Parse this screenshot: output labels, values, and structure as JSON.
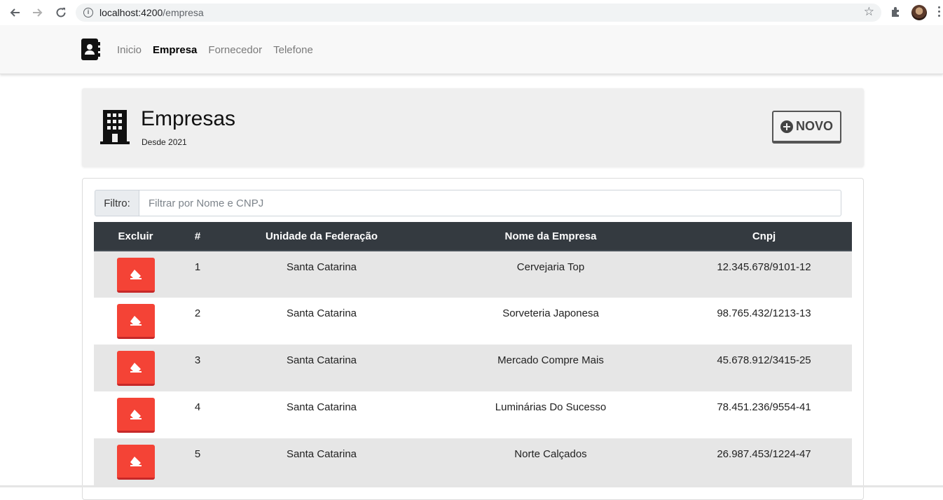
{
  "browser": {
    "url_host": "localhost:4200",
    "url_path": "/empresa"
  },
  "navbar": {
    "links": [
      {
        "label": "Inicio",
        "active": false
      },
      {
        "label": "Empresa",
        "active": true
      },
      {
        "label": "Fornecedor",
        "active": false
      },
      {
        "label": "Telefone",
        "active": false
      }
    ]
  },
  "header": {
    "title": "Empresas",
    "subtitle": "Desde 2021",
    "new_button_label": "NOVO"
  },
  "filter": {
    "label": "Filtro:",
    "placeholder": "Filtrar por Nome e CNPJ",
    "value": ""
  },
  "table": {
    "columns": [
      "Excluir",
      "#",
      "Unidade da Federação",
      "Nome da Empresa",
      "Cnpj"
    ],
    "rows": [
      {
        "id": "1",
        "uf": "Santa Catarina",
        "nome": "Cervejaria Top",
        "cnpj": "12.345.678/9101-12"
      },
      {
        "id": "2",
        "uf": "Santa Catarina",
        "nome": "Sorveteria Japonesa",
        "cnpj": "98.765.432/1213-13"
      },
      {
        "id": "3",
        "uf": "Santa Catarina",
        "nome": "Mercado Compre Mais",
        "cnpj": "45.678.912/3415-25"
      },
      {
        "id": "4",
        "uf": "Santa Catarina",
        "nome": "Luminárias Do Sucesso",
        "cnpj": "78.451.236/9554-41"
      },
      {
        "id": "5",
        "uf": "Santa Catarina",
        "nome": "Norte Calçados",
        "cnpj": "26.987.453/1224-47"
      }
    ]
  },
  "colors": {
    "table_header_bg": "#343a40",
    "delete_button": "#f44336",
    "striped_row": "#e6e6e6"
  }
}
